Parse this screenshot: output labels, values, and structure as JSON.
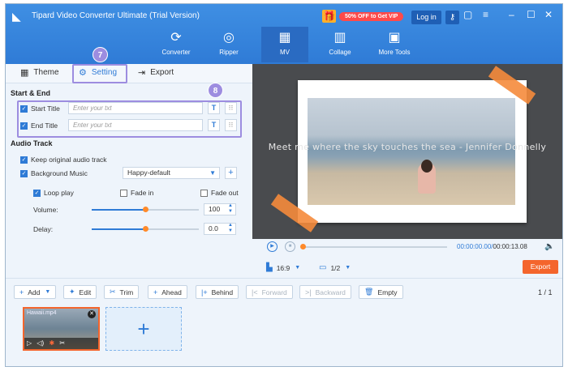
{
  "window": {
    "title": "Tipard Video Converter Ultimate (Trial Version)",
    "promo": "50% OFF to Get VIP",
    "login": "Log in"
  },
  "nav": [
    {
      "label": "Converter",
      "icon": "converter-icon"
    },
    {
      "label": "Ripper",
      "icon": "ripper-icon"
    },
    {
      "label": "MV",
      "icon": "mv-icon",
      "active": true
    },
    {
      "label": "Collage",
      "icon": "collage-icon"
    },
    {
      "label": "More Tools",
      "icon": "toolbox-icon"
    }
  ],
  "tabs": {
    "theme": "Theme",
    "setting": "Setting",
    "export": "Export"
  },
  "steps": {
    "setting": "7",
    "titles": "8"
  },
  "start_end": {
    "section": "Start & End",
    "start_label": "Start Title",
    "end_label": "End Title",
    "placeholder": "Enter your txt"
  },
  "audio": {
    "section": "Audio Track",
    "keep_original": "Keep original audio track",
    "background_music": "Background Music",
    "music_selected": "Happy-default",
    "loop": "Loop play",
    "fade_in": "Fade in",
    "fade_out": "Fade out",
    "volume_label": "Volume:",
    "volume_value": "100",
    "delay_label": "Delay:",
    "delay_value": "0.0",
    "volume_level": 0.5,
    "delay_level": 0.5
  },
  "preview": {
    "caption": "Meet me where the sky touches the sea - Jennifer Donnelly"
  },
  "player": {
    "time_current": "00:00:00.00",
    "time_total": "00:00:13.08",
    "ratio": "16:9",
    "page": "1/2",
    "export": "Export"
  },
  "toolbar": {
    "add": "Add",
    "edit": "Edit",
    "trim": "Trim",
    "ahead": "Ahead",
    "behind": "Behind",
    "forward": "Forward",
    "backward": "Backward",
    "empty": "Empty",
    "page_current": "1",
    "page_total": "1"
  },
  "timeline": {
    "clip_name": "Hawaii.mp4",
    "add_symbol": "+"
  },
  "colors": {
    "accent": "#2f7bd6",
    "highlight": "#9d8de0",
    "export": "#f4652c"
  }
}
